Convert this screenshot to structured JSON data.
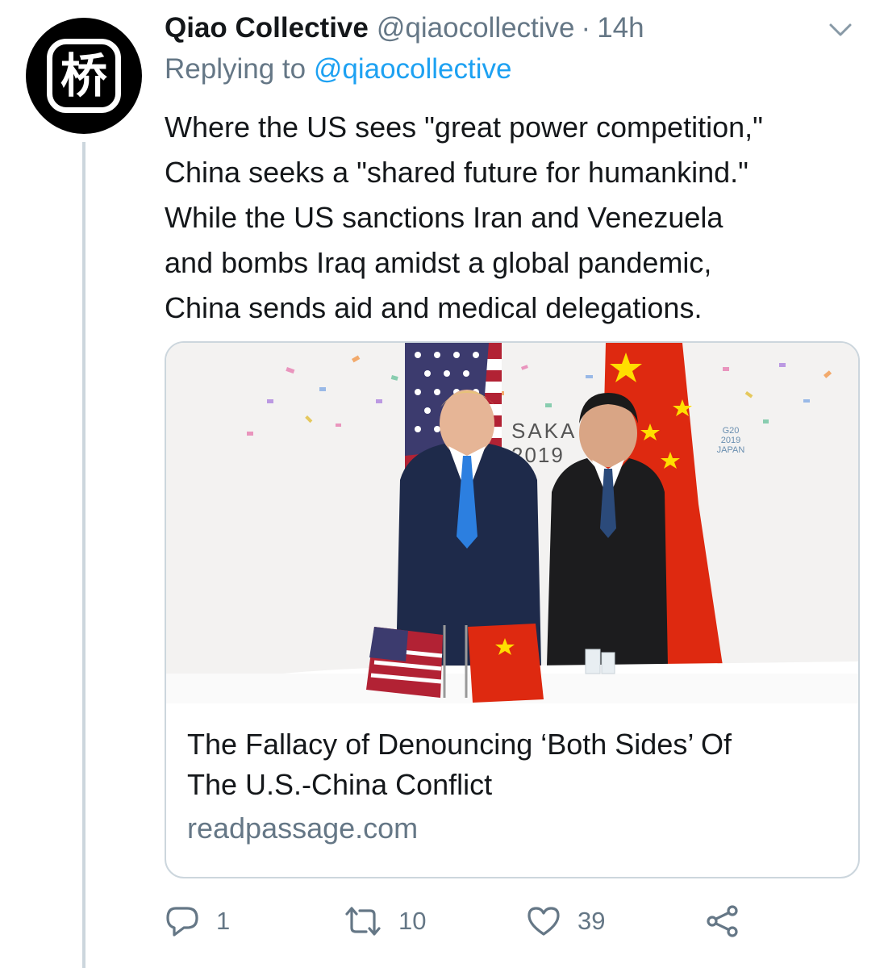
{
  "tweet": {
    "avatar_glyph": "桥",
    "display_name": "Qiao Collective",
    "handle": "@qiaocollective",
    "separator": "·",
    "time": "14h",
    "reply_prefix": "Replying to ",
    "reply_to": "@qiaocollective",
    "body_lines": [
      "Where the US sees \"great power competition,\"",
      "China seeks a \"shared future for humankind.\"",
      "While the US sanctions Iran and Venezuela",
      "and bombs Iraq amidst a global pandemic,",
      "China sends aid and medical delegations."
    ]
  },
  "card": {
    "image": {
      "backdrop_text_line1": "SAKA",
      "backdrop_text_line2": "2019",
      "logo_line1": "G20",
      "logo_line2": "2019",
      "logo_line3": "JAPAN"
    },
    "title_lines": [
      "The Fallacy of Denouncing ‘Both Sides’ Of",
      "The U.S.-China Conflict"
    ],
    "domain": "readpassage.com"
  },
  "actions": {
    "reply_count": "1",
    "retweet_count": "10",
    "like_count": "39"
  },
  "icons": {
    "reply": "reply-icon",
    "retweet": "retweet-icon",
    "like": "heart-icon",
    "share": "share-icon",
    "caret": "chevron-down-icon"
  },
  "colors": {
    "text_primary": "#14171a",
    "text_secondary": "#657786",
    "link": "#1da1f2",
    "border": "#ccd6dd"
  }
}
